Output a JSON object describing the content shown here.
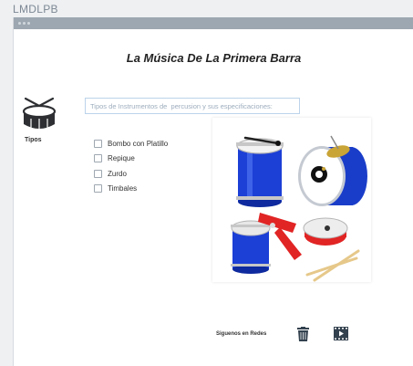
{
  "app": {
    "title": "LMDLPB"
  },
  "page": {
    "title": "La Música De La Primera Barra"
  },
  "sidebar": {
    "tipos_label": "Tipos"
  },
  "search": {
    "placeholder": "Tipos de Instrumentos de  percusion y sus especificaciones:"
  },
  "instruments": {
    "options": [
      {
        "label": "Bombo con Platillo",
        "checked": false
      },
      {
        "label": "Repique",
        "checked": false
      },
      {
        "label": "Zurdo",
        "checked": false
      },
      {
        "label": "Timbales",
        "checked": false
      }
    ]
  },
  "footer": {
    "social_label": "Siguenos en Redes"
  },
  "icons": [
    "drum-icon",
    "trash-icon",
    "video-icon"
  ],
  "colors": {
    "titlebar": "#9da7b1",
    "drum_blue": "#1c3fd6",
    "drum_red": "#e12424",
    "search_border": "#bcd3ea"
  }
}
